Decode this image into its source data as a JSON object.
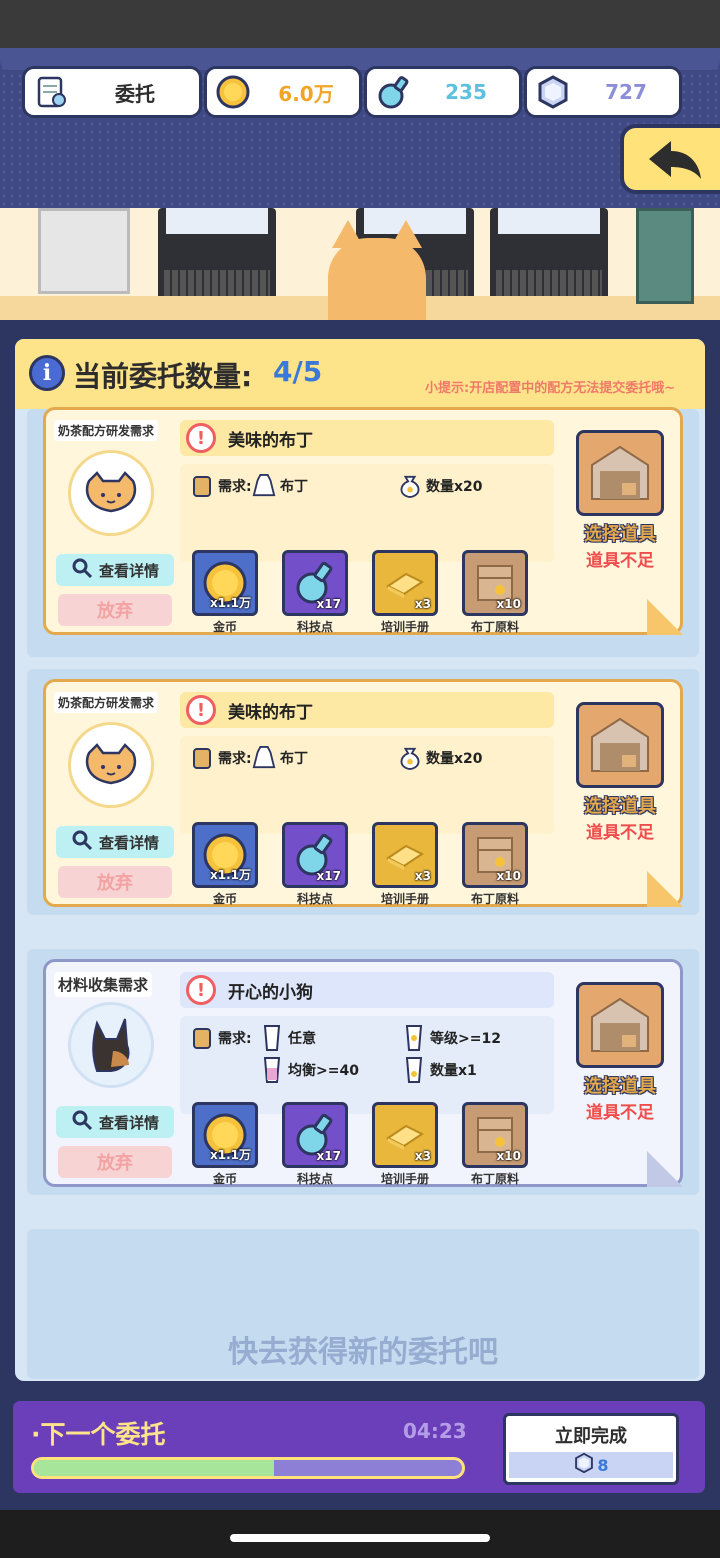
{
  "header": {
    "title": "委托",
    "coins": "6.0万",
    "tech": "235",
    "gems": "727"
  },
  "panel": {
    "title": "当前委托数量:",
    "count": "4/5",
    "tip": "小提示:开店配置中的配方无法提交委托哦~"
  },
  "cards": [
    {
      "tag": "奶茶配方研发需求",
      "title": "美味的布丁",
      "req_label": "需求:",
      "req_a": "布丁",
      "req_b": "数量x20",
      "detail": "查看详情",
      "quit": "放弃",
      "pick": "选择道具",
      "shortage": "道具不足",
      "rewards": [
        {
          "qty": "x1.1万",
          "name": "金币"
        },
        {
          "qty": "x17",
          "name": "科技点"
        },
        {
          "qty": "x3",
          "name": "培训手册"
        },
        {
          "qty": "x10",
          "name": "布丁原料"
        }
      ]
    },
    {
      "tag": "奶茶配方研发需求",
      "title": "美味的布丁",
      "req_label": "需求:",
      "req_a": "布丁",
      "req_b": "数量x20",
      "detail": "查看详情",
      "quit": "放弃",
      "pick": "选择道具",
      "shortage": "道具不足",
      "rewards": [
        {
          "qty": "x1.1万",
          "name": "金币"
        },
        {
          "qty": "x17",
          "name": "科技点"
        },
        {
          "qty": "x3",
          "name": "培训手册"
        },
        {
          "qty": "x10",
          "name": "布丁原料"
        }
      ]
    },
    {
      "tag": "材料收集需求",
      "title": "开心的小狗",
      "req_label": "需求:",
      "req_a": "任意",
      "req_b": "等级>=12",
      "req_c": "均衡>=40",
      "req_d": "数量x1",
      "detail": "查看详情",
      "quit": "放弃",
      "pick": "选择道具",
      "shortage": "道具不足",
      "rewards": [
        {
          "qty": "x1.1万",
          "name": "金币"
        },
        {
          "qty": "x17",
          "name": "科技点"
        },
        {
          "qty": "x3",
          "name": "培训手册"
        },
        {
          "qty": "x10",
          "name": "布丁原料"
        }
      ]
    }
  ],
  "empty_slot": "快去获得新的委托吧",
  "next": {
    "title": "·下一个委托",
    "time": "04:23",
    "progress": 0.56,
    "finish_label": "立即完成",
    "finish_cost": "8"
  }
}
